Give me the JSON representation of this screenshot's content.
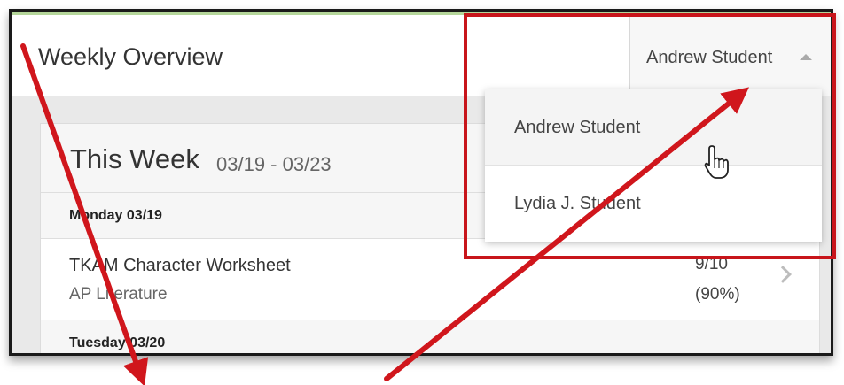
{
  "header": {
    "title": "Weekly Overview"
  },
  "student_selector": {
    "selected": "Andrew Student",
    "caret_icon": "caret-up-icon"
  },
  "dropdown": {
    "options": [
      "Andrew Student",
      "Lydia J. Student"
    ]
  },
  "week": {
    "title": "This Week",
    "range": "03/19 - 03/23"
  },
  "days": [
    {
      "label": "Monday 03/19"
    },
    {
      "label": "Tuesday 03/20"
    }
  ],
  "assignment": {
    "title": "TKAM Character Worksheet",
    "course": "AP Literature",
    "score": "9/10",
    "percent": "(90%)"
  },
  "colors": {
    "annotation": "#d0161c",
    "accent_line": "#b5d69a"
  },
  "icons": {
    "pointer": "hand-pointer-icon",
    "row_arrow": "chevron-right-icon"
  }
}
